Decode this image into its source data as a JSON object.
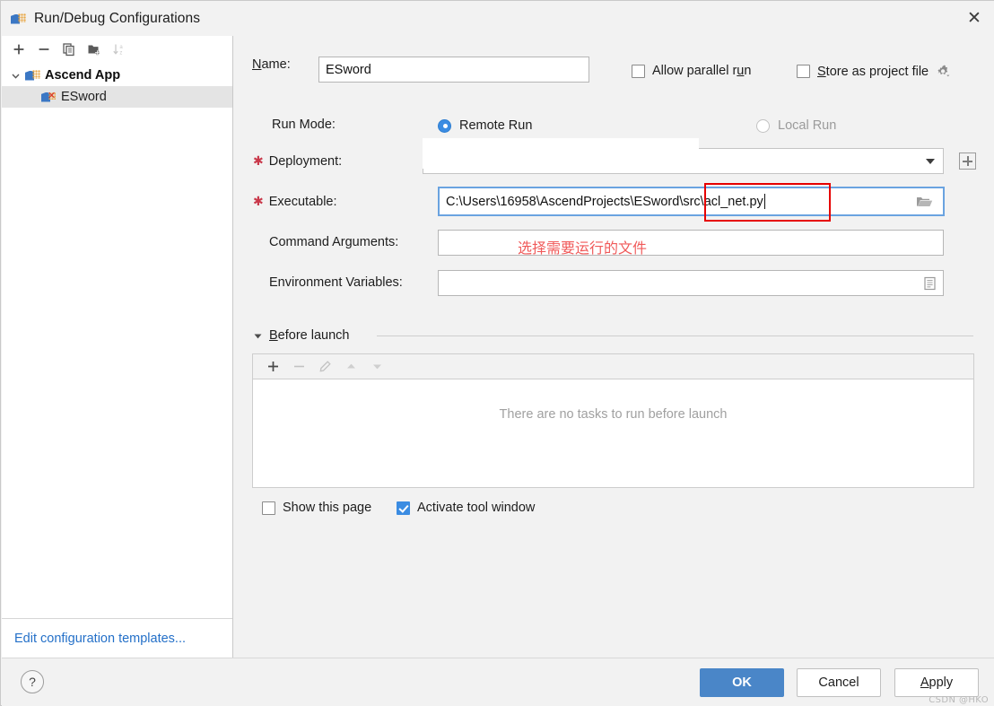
{
  "window": {
    "title": "Run/Debug Configurations",
    "close_label": "✕",
    "app_icon": "ascend-app-icon"
  },
  "sidebar": {
    "toolbar": [
      {
        "name": "add",
        "icon": "plus-icon",
        "enabled": true
      },
      {
        "name": "remove",
        "icon": "minus-icon",
        "enabled": true
      },
      {
        "name": "copy",
        "icon": "copy-icon",
        "enabled": true
      },
      {
        "name": "new-folder",
        "icon": "folder-add-icon",
        "enabled": true
      },
      {
        "name": "sort-alphabetically",
        "icon": "sort-az-icon",
        "enabled": false
      }
    ],
    "tree": [
      {
        "label": "Ascend App",
        "type": "group",
        "expanded": true,
        "selected": false,
        "icon": "ascend-app-icon"
      },
      {
        "label": "ESword",
        "type": "child",
        "selected": true,
        "icon": "ascend-config-error-icon"
      }
    ],
    "edit_templates_link": "Edit configuration templates...",
    "link_color": "#2470c8"
  },
  "form": {
    "name_label": "Name:",
    "name_value": "ESword",
    "allow_parallel_run": {
      "label": "Allow parallel run",
      "checked": false
    },
    "store_as_project_file": {
      "label": "Store as project file",
      "checked": false,
      "gear_icon": "gear-icon"
    },
    "run_mode_label": "Run Mode:",
    "run_mode_options": [
      {
        "label": "Remote Run",
        "selected": true,
        "disabled": false
      },
      {
        "label": "Local Run",
        "selected": false,
        "disabled": true
      }
    ],
    "deployment": {
      "label": "Deployment:",
      "required": true,
      "value": "",
      "caret_icon": "chevron-down-icon",
      "add_icon": "add-box-icon"
    },
    "executable": {
      "label": "Executable:",
      "required": true,
      "value": "C:\\Users\\16958\\AscendProjects\\ESword\\src\\acl_net.py",
      "browse_icon": "folder-open-icon",
      "focused": true
    },
    "command_arguments": {
      "label": "Command Arguments:",
      "value": ""
    },
    "environment_variables": {
      "label": "Environment Variables:",
      "value": "",
      "editor_icon": "list-editor-icon"
    }
  },
  "before_launch": {
    "section_label": "Before launch",
    "collapse_icon": "triangle-down-icon",
    "toolbar": [
      {
        "name": "add-task",
        "icon": "plus-icon",
        "enabled": true
      },
      {
        "name": "remove-task",
        "icon": "minus-icon",
        "enabled": false
      },
      {
        "name": "edit-task",
        "icon": "pencil-icon",
        "enabled": false
      },
      {
        "name": "move-up",
        "icon": "arrow-up-icon",
        "enabled": false
      },
      {
        "name": "move-down",
        "icon": "arrow-down-icon",
        "enabled": false
      }
    ],
    "empty_text": "There are no tasks to run before launch",
    "show_this_page": {
      "label": "Show this page",
      "checked": false
    },
    "activate_tool_window": {
      "label": "Activate tool window",
      "checked": true
    }
  },
  "annotation": {
    "note_text": "选择需要运行的文件",
    "note_color": "#f05a5a",
    "box_color": "#e60000"
  },
  "footer": {
    "help_label": "?",
    "ok_label": "OK",
    "cancel_label": "Cancel",
    "apply_label": "Apply",
    "ok_color": "#4a86c8",
    "watermark": "CSDN @HKO"
  }
}
